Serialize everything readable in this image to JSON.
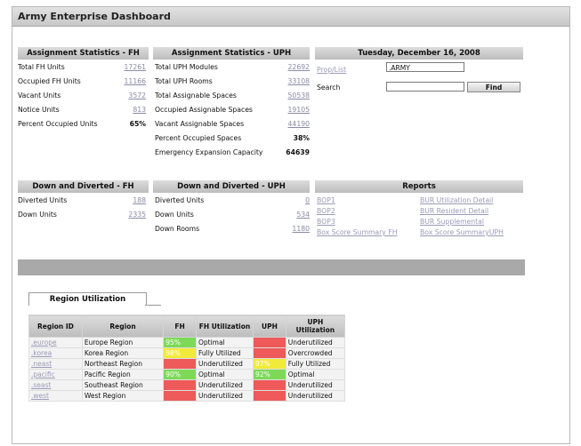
{
  "app_title": "Army Enterprise Dashboard",
  "fh_stats": {
    "header": "Assignment Statistics - FH",
    "rows": [
      {
        "label": "Total FH Units",
        "value": "17261"
      },
      {
        "label": "Occupied FH Units",
        "value": "11166"
      },
      {
        "label": "Vacant Units",
        "value": "3572"
      },
      {
        "label": "Notice Units",
        "value": "813"
      },
      {
        "label": "Percent Occupied Units",
        "value": "65%"
      }
    ]
  },
  "uph_stats": {
    "header": "Assignment Statistics - UPH",
    "rows": [
      {
        "label": "Total UPH Modules",
        "value": "22692"
      },
      {
        "label": "Total UPH Rooms",
        "value": "33108"
      },
      {
        "label": "Total Assignable Spaces",
        "value": "50538"
      },
      {
        "label": "Occupied Assignable Spaces",
        "value": "19105"
      },
      {
        "label": "Vacant Assignable Spaces",
        "value": "44190"
      },
      {
        "label": "Percent Occupied Spaces",
        "value": "38%"
      },
      {
        "label": "Emergency Expansion Capacity",
        "value": "64639"
      }
    ]
  },
  "date_panel": {
    "header": "Tuesday, December 16, 2008",
    "prop_list_label": "Prop/List",
    "prop_list_value": ".ARMY",
    "search_label": "Search",
    "search_value": "",
    "find_label": "Find"
  },
  "dd_fh": {
    "header": "Down and Diverted - FH",
    "rows": [
      {
        "label": "Diverted Units",
        "value": "188"
      },
      {
        "label": "Down Units",
        "value": "2335"
      }
    ]
  },
  "dd_uph": {
    "header": "Down and Diverted - UPH",
    "rows": [
      {
        "label": "Diverted Units",
        "value": "0"
      },
      {
        "label": "Down Units",
        "value": "534"
      },
      {
        "label": "Down Rooms",
        "value": "1180"
      }
    ]
  },
  "reports": {
    "header": "Reports",
    "links": [
      [
        "BOP1",
        "BUR Utilization Detail"
      ],
      [
        "BOP2",
        "BUR Resident Detail"
      ],
      [
        "BOP3",
        "BUR Supplemental"
      ],
      [
        "Box Score Summary FH",
        "Box Score SummaryUPH"
      ]
    ]
  },
  "region_tab": "Region Utilization",
  "region_table": {
    "headers": [
      "Region ID",
      "Region",
      "FH",
      "FH Utilization",
      "UPH",
      "UPH Utilization"
    ],
    "rows": [
      {
        "id": ".europe",
        "region": "Europe Region",
        "fh": "95%",
        "fh_util": "Optimal",
        "uph": "",
        "uph_util": "Underutilized",
        "fh_color": "#7ed957",
        "uph_color": "#ee5a5a"
      },
      {
        "id": ".korea",
        "region": "Korea Region",
        "fh": "98%",
        "fh_util": "Fully Utilized",
        "uph": "",
        "uph_util": "Overcrowded",
        "fh_color": "#f2ea3a",
        "uph_color": "#ee5a5a"
      },
      {
        "id": ".neast",
        "region": "Northeast Region",
        "fh": "",
        "fh_util": "Underutilized",
        "uph": "97%",
        "uph_util": "Fully Utilized",
        "fh_color": "#ee5a5a",
        "uph_color": "#f2ea3a"
      },
      {
        "id": ".pacific",
        "region": "Pacific Region",
        "fh": "90%",
        "fh_util": "Optimal",
        "uph": "92%",
        "uph_util": "Optimal",
        "fh_color": "#7ed957",
        "uph_color": "#7ed957"
      },
      {
        "id": ".seast",
        "region": "Southeast Region",
        "fh": "",
        "fh_util": "Underutilized",
        "uph": "",
        "uph_util": "Underutilized",
        "fh_color": "#ee5a5a",
        "uph_color": "#ee5a5a"
      },
      {
        "id": ".west",
        "region": "West Region",
        "fh": "",
        "fh_util": "Underutilized",
        "uph": "",
        "uph_util": "Underutilized",
        "fh_color": "#ee5a5a",
        "uph_color": "#ee5a5a"
      }
    ]
  }
}
